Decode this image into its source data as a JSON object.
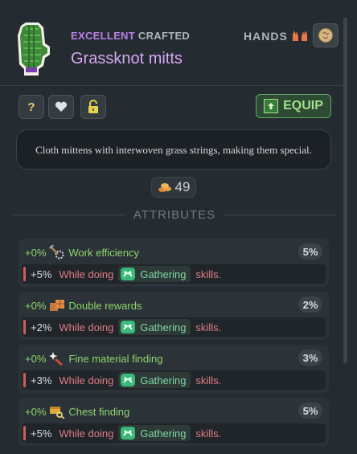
{
  "item": {
    "quality": "EXCELLENT",
    "craft": "CRAFTED",
    "name": "Grassknot mitts",
    "slot": "HANDS",
    "description": "Cloth mittens with interwoven grass strings, making them special.",
    "value": "49"
  },
  "actions": {
    "help_label": "?",
    "equip_label": "EQUIP"
  },
  "attributes_title": "ATTRIBUTES",
  "attributes": [
    {
      "base": "+0%",
      "name": "Work efficiency",
      "total": "5%",
      "bonus": "+5%",
      "while": "While doing",
      "skill": "Gathering",
      "suffix": "skills."
    },
    {
      "base": "+0%",
      "name": "Double rewards",
      "total": "2%",
      "bonus": "+2%",
      "while": "While doing",
      "skill": "Gathering",
      "suffix": "skills."
    },
    {
      "base": "+0%",
      "name": "Fine material finding",
      "total": "3%",
      "bonus": "+3%",
      "while": "While doing",
      "skill": "Gathering",
      "suffix": "skills."
    },
    {
      "base": "+0%",
      "name": "Chest finding",
      "total": "5%",
      "bonus": "+5%",
      "while": "While doing",
      "skill": "Gathering",
      "suffix": "skills."
    }
  ],
  "colors": {
    "quality": "#b782e8",
    "name": "#d6a8f5",
    "equip": "#9ee28d",
    "attribute": "#8fd46e",
    "condition": "#e07d86",
    "skill": "#7fd6a2"
  },
  "icons": {
    "item": "green-mitten-icon",
    "slot": "hands-icon",
    "rune": "rune-stone-icon",
    "favorite": "heart-icon",
    "lock": "padlock-icon",
    "equip": "up-arrow-icon",
    "value": "coin-pile-icon",
    "skill": "gathering-icon"
  }
}
